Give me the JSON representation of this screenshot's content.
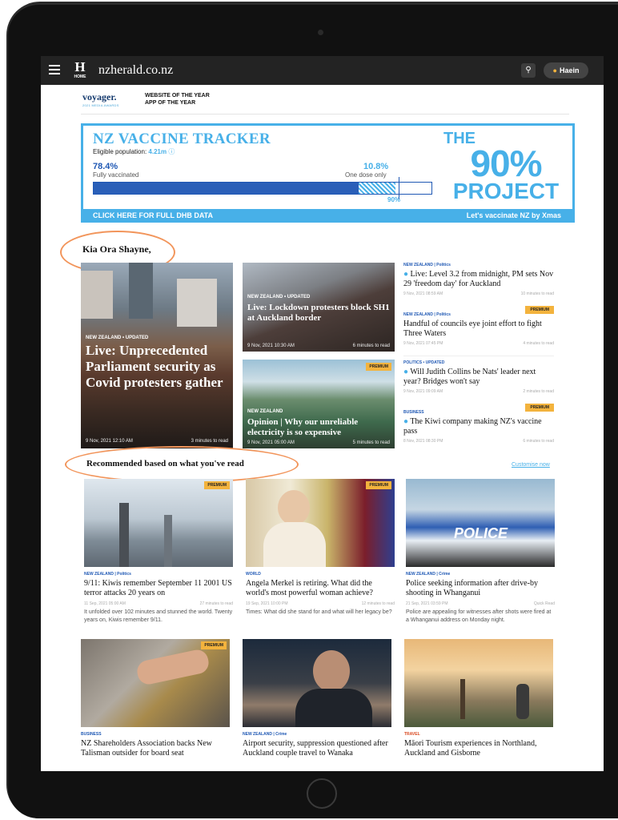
{
  "topbar": {
    "site_name": "nzherald.co.nz",
    "logo_text": "H",
    "logo_sub": "HOME",
    "user_name": "Haein",
    "menu_icon": "hamburger-icon",
    "search_icon": "search-icon"
  },
  "awards": {
    "brand": "voyager.",
    "brand_sub": "2021 MEDIA AWARDS",
    "line1": "WEBSITE OF THE YEAR",
    "line2": "APP OF THE YEAR"
  },
  "tracker": {
    "title": "NZ VACCINE TRACKER",
    "eligible_label": "Eligible population:",
    "eligible_value": "4.21m",
    "fully_pct": "78.4%",
    "fully_label": "Fully vaccinated",
    "one_dose_pct": "10.8%",
    "one_dose_label": "One dose only",
    "goal_label": "90%",
    "fully_value": 78.4,
    "one_dose_value": 10.8,
    "goal_value": 90,
    "cta": "CLICK HERE FOR FULL DHB DATA",
    "tagline": "Let's vaccinate NZ by Xmas",
    "project_the": "THE",
    "project_num": "90%",
    "project_word": "PROJECT",
    "accent_color": "#47b0e8",
    "bar_color": "#2a5fb8"
  },
  "greeting": "Kia Ora Shayne,",
  "lead": {
    "tag": "NEW ZEALAND  •  UPDATED",
    "title": "Live: Unprecedented Parliament security as Covid protesters gather",
    "date": "9 Nov, 2021 12:10 AM",
    "read": "3 minutes to read"
  },
  "middle": [
    {
      "tag": "NEW ZEALAND  •  UPDATED",
      "title": "Live: Lockdown protesters block SH1 at Auckland border",
      "date": "9 Nov, 2021 10:30 AM",
      "read": "6 minutes to read"
    },
    {
      "premium": "PREMIUM",
      "tag": "NEW ZEALAND",
      "title": "Opinion | Why our unreliable electricity is so expensive",
      "date": "9 Nov, 2021 05:00 AM",
      "read": "5 minutes to read"
    }
  ],
  "right": [
    {
      "tag": "NEW ZEALAND | Politics",
      "title": "Live: Level 3.2 from midnight, PM sets Nov 29 'freedom day' for Auckland",
      "date": "9 Nov, 2021 08:59 AM",
      "read": "10 minutes to read"
    },
    {
      "premium": "PREMIUM",
      "tag": "NEW ZEALAND | Politics",
      "title": "Handful of councils eye joint effort to fight Three Waters",
      "date": "9 Nov, 2021 07:45 PM",
      "read": "4 minutes to read"
    },
    {
      "tag": "POLITICS  •  UPDATED",
      "title": "Will Judith Collins be Nats' leader next year? Bridges won't say",
      "date": "9 Nov, 2021 09:09 AM",
      "read": "2 minutes to read"
    },
    {
      "premium": "PREMIUM",
      "tag": "BUSINESS",
      "title": "The Kiwi company making NZ's vaccine pass",
      "date": "8 Nov, 2021 08:30 PM",
      "read": "6 minutes to read"
    }
  ],
  "recommended": {
    "title": "Recommended based on what you've read",
    "customise": "Customise now",
    "items": [
      {
        "premium": "PREMIUM",
        "tag": "NEW ZEALAND | Politics",
        "title": "9/11: Kiwis remember September 11 2001 US terror attacks 20 years on",
        "date": "11 Sep, 2021 05:00 AM",
        "read": "27 minutes to read",
        "desc": "It unfolded over 102 minutes and stunned the world. Twenty years on, Kiwis remember 9/11."
      },
      {
        "premium": "PREMIUM",
        "tag": "WORLD",
        "title": "Angela Merkel is retiring. What did the world's most powerful woman achieve?",
        "date": "19 Sep, 2021 10:00 PM",
        "read": "12 minutes to read",
        "desc": "Times: What did she stand for and what will her legacy be?"
      },
      {
        "tag": "NEW ZEALAND | Crime",
        "title": "Police seeking information after drive-by shooting in Whanganui",
        "date": "21 Sep, 2021 03:59 PM",
        "read": "Quick Read",
        "desc": "Police are appealing for witnesses after shots were fired at a Whanganui address on Monday night."
      },
      {
        "premium": "PREMIUM",
        "tag": "BUSINESS",
        "title": "NZ Shareholders Association backs New Talisman outsider for board seat"
      },
      {
        "tag": "NEW ZEALAND | Crime",
        "title": "Airport security, suppression questioned after Auckland couple travel to Wanaka"
      },
      {
        "tag": "TRAVEL",
        "title": "Māori Tourism experiences in Northland, Auckland and Gisborne"
      }
    ]
  },
  "police_sign": "POLICE"
}
